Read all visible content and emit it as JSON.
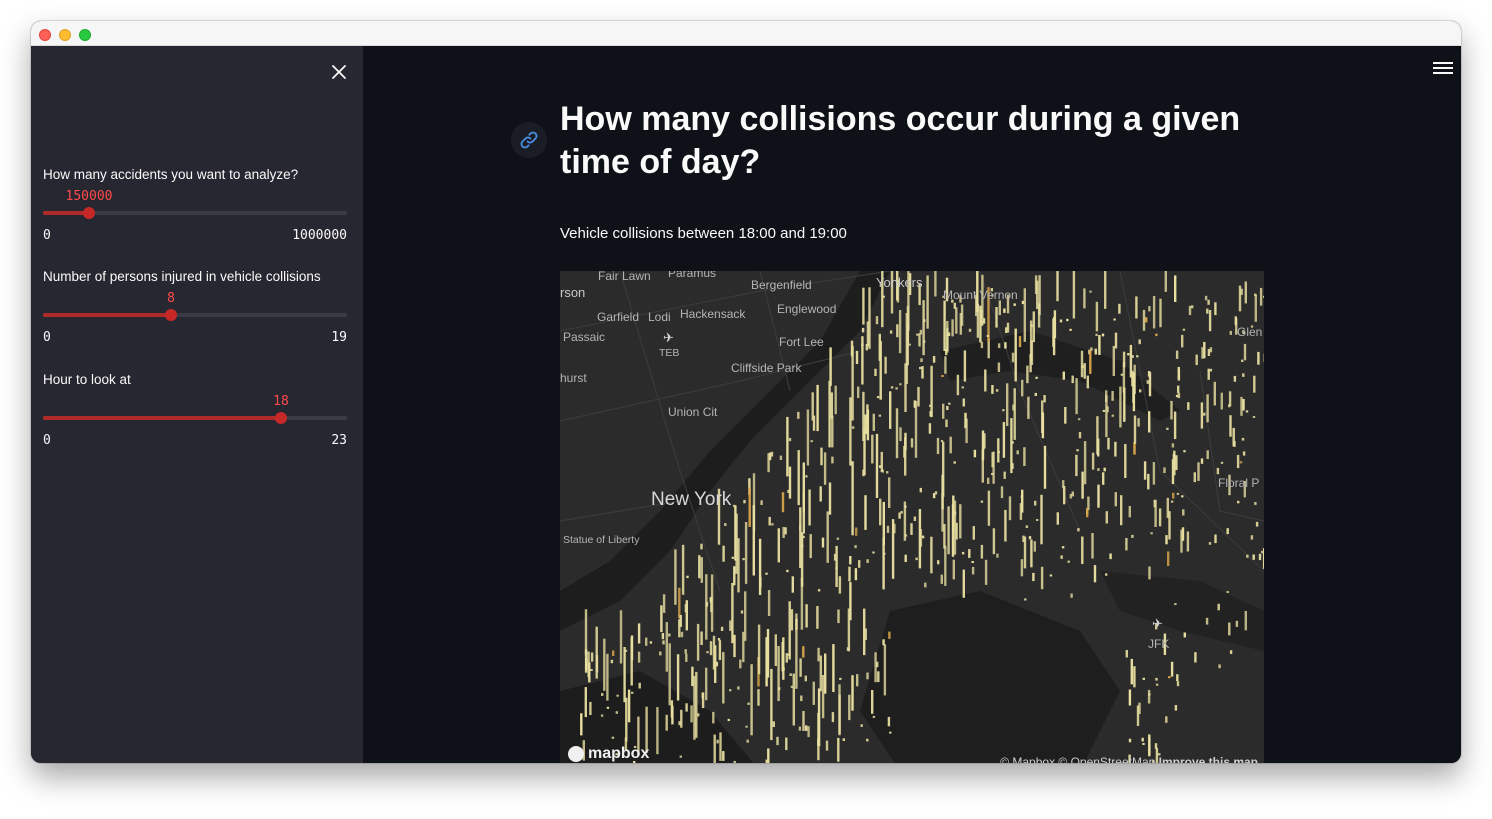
{
  "sidebar": {
    "close_icon": "close-icon",
    "sliders": [
      {
        "label": "How many accidents you want to analyze?",
        "value": "150000",
        "min": "0",
        "max": "1000000",
        "fraction": 0.15
      },
      {
        "label": "Number of persons injured in vehicle collisions",
        "value": "8",
        "min": "0",
        "max": "19",
        "fraction": 0.421
      },
      {
        "label": "Hour to look at",
        "value": "18",
        "min": "0",
        "max": "23",
        "fraction": 0.783
      }
    ]
  },
  "main": {
    "menu_icon": "hamburger-menu-icon",
    "anchor_icon": "link-icon",
    "title": "How many collisions occur during a given time of day?",
    "subtitle": "Vehicle collisions between 18:00 and 19:00"
  },
  "map": {
    "labels": {
      "fair_lawn": "Fair Lawn",
      "paramus": "Paramus",
      "bergenfield": "Bergenfield",
      "yonkers": "Yonkers",
      "mount_vernon": "Mount Vernon",
      "rson": "rson",
      "garfield": "Garfield",
      "lodi": "Lodi",
      "hackensack": "Hackensack",
      "englewood": "Englewood",
      "passaic": "Passaic",
      "teb": "TEB",
      "fort_lee": "Fort Lee",
      "glen": "Glen",
      "hurst": "hurst",
      "cliffside_park": "Cliffside Park",
      "union_city": "Union Cit",
      "new_york": "New York",
      "floral_park": "Floral P",
      "statue_of_liberty": "Statue of Liberty",
      "jfk": "JFK"
    },
    "logo_text": "mapbox",
    "attribution": "© Mapbox © OpenStreetMap",
    "improve_link": "Improve this map",
    "bar_color": "#e8dfa0",
    "accent_bar_color": "#d9a74a"
  },
  "colors": {
    "accent": "#ff4b4b",
    "sidebar_bg": "#262730",
    "main_bg": "#0e1117"
  }
}
